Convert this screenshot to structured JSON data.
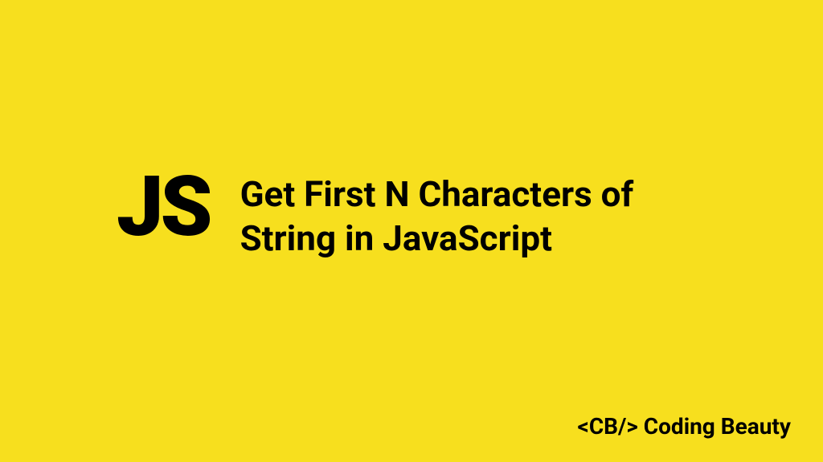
{
  "logo": "JS",
  "title_line1": "Get First N Characters of",
  "title_line2": "String in JavaScript",
  "footer": "<CB/> Coding Beauty"
}
